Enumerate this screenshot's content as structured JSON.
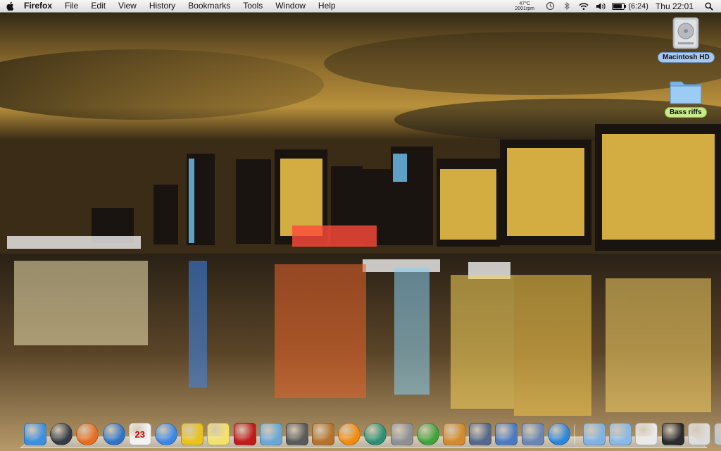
{
  "menubar": {
    "apple_icon": "apple-icon",
    "app_name": "Firefox",
    "menus": [
      "File",
      "Edit",
      "View",
      "History",
      "Bookmarks",
      "Tools",
      "Window",
      "Help"
    ],
    "status": {
      "temperature": "47°C",
      "fan_speed": "2001rpm",
      "battery_time": "(6:24)",
      "clock": "Thu 22:01",
      "icons": [
        "time-machine-icon",
        "bluetooth-icon",
        "wifi-icon",
        "volume-icon",
        "battery-icon",
        "spotlight-icon"
      ]
    }
  },
  "desktop": {
    "icons": [
      {
        "label": "Macintosh HD",
        "icon": "hard-drive-icon"
      },
      {
        "label": "Bass riffs",
        "icon": "folder-icon"
      }
    ]
  },
  "dock": {
    "apps": [
      {
        "name": "Finder",
        "icon": "finder-icon",
        "color": "#3d8fe0"
      },
      {
        "name": "Dashboard",
        "icon": "dashboard-icon",
        "color": "#333b45"
      },
      {
        "name": "Firefox",
        "icon": "firefox-icon",
        "color": "#e66d1f"
      },
      {
        "name": "Thunderbird",
        "icon": "thunderbird-icon",
        "color": "#2f74c6"
      },
      {
        "name": "iCal",
        "icon": "calendar-icon",
        "color": "#f3f3f3",
        "text": "23"
      },
      {
        "name": "iTunes",
        "icon": "itunes-icon",
        "color": "#3c87e6"
      },
      {
        "name": "Cyberduck",
        "icon": "cyberduck-icon",
        "color": "#e8c31c"
      },
      {
        "name": "Stickies",
        "icon": "stickies-icon",
        "color": "#f2e16a"
      },
      {
        "name": "Photo Booth",
        "icon": "photobooth-icon",
        "color": "#c01b1b"
      },
      {
        "name": "iPhoto",
        "icon": "iphoto-icon",
        "color": "#6aa7d6"
      },
      {
        "name": "iMovie",
        "icon": "imovie-icon",
        "color": "#5a5a5a"
      },
      {
        "name": "GarageBand",
        "icon": "garageband-icon",
        "color": "#b5722b"
      },
      {
        "name": "VLC",
        "icon": "vlc-icon",
        "color": "#f28a0c"
      },
      {
        "name": "Time Machine",
        "icon": "time-machine-app-icon",
        "color": "#2c8f73"
      },
      {
        "name": "System Preferences",
        "icon": "system-preferences-icon",
        "color": "#8d8f93"
      },
      {
        "name": "uTorrent",
        "icon": "utorrent-icon",
        "color": "#3fa33a"
      },
      {
        "name": "Keynote",
        "icon": "keynote-icon",
        "color": "#d28a2b"
      },
      {
        "name": "Automator",
        "icon": "automator-icon",
        "color": "#55678a"
      },
      {
        "name": "Grapher",
        "icon": "grapher-icon",
        "color": "#4c7ac0"
      },
      {
        "name": "Preview",
        "icon": "preview-icon",
        "color": "#6b86b4"
      },
      {
        "name": "QuickTime",
        "icon": "quicktime-icon",
        "color": "#2b86d9"
      }
    ],
    "stacks": [
      {
        "name": "Applications",
        "icon": "applications-folder-icon",
        "color": "#7fb2e2"
      },
      {
        "name": "Documents",
        "icon": "documents-folder-icon",
        "color": "#8ab8e6"
      },
      {
        "name": "Mail",
        "icon": "mail-icon",
        "color": "#e9e9e9"
      },
      {
        "name": "Terminal",
        "icon": "terminal-icon",
        "color": "#2b2b2b"
      },
      {
        "name": "Downloads",
        "icon": "downloads-icon",
        "color": "#dcdcdc"
      },
      {
        "name": "Trash",
        "icon": "trash-icon",
        "color": "#bfc4c8"
      }
    ]
  }
}
